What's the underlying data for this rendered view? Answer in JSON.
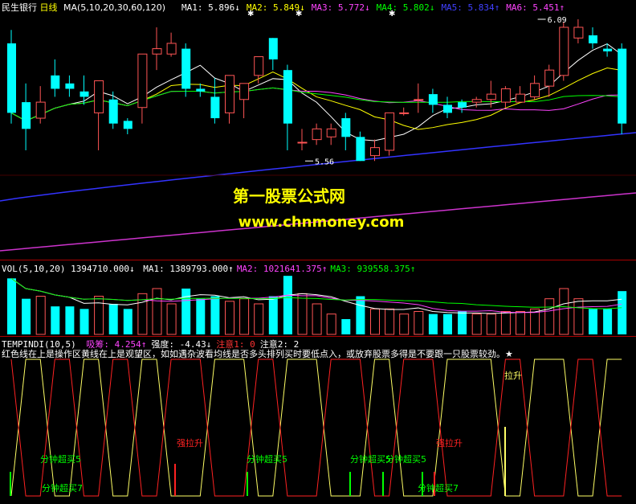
{
  "header": {
    "stock_name": "民生银行",
    "period": "日线",
    "ma_label": "MA(5,10,20,30,60,120)",
    "ma": [
      {
        "label": "MA1:",
        "value": "5.896",
        "arrow": "↓",
        "color": "#ffffff"
      },
      {
        "label": "MA2:",
        "value": "5.849",
        "arrow": "↓",
        "color": "#ffff00"
      },
      {
        "label": "MA3:",
        "value": "5.772",
        "arrow": "↓",
        "color": "#ff44ff"
      },
      {
        "label": "MA4:",
        "value": "5.802",
        "arrow": "↓",
        "color": "#00ff00"
      },
      {
        "label": "MA5:",
        "value": "5.834",
        "arrow": "↑",
        "color": "#4040ff"
      },
      {
        "label": "MA6:",
        "value": "5.451",
        "arrow": "↑",
        "color": "#ff44ff"
      }
    ]
  },
  "watermark": {
    "line1": "第一股票公式网",
    "line2": "www.chnmoney.com"
  },
  "vol_header": {
    "label": "VOL(5,10,20)",
    "value": "1394710.000",
    "arrow": "↓",
    "ma": [
      {
        "label": "MA1:",
        "value": "1389793.000",
        "arrow": "↑",
        "color": "#ffffff"
      },
      {
        "label": "MA2:",
        "value": "1021641.375",
        "arrow": "↑",
        "color": "#ff44ff"
      },
      {
        "label": "MA3:",
        "value": "939558.375",
        "arrow": "↑",
        "color": "#00ff00"
      }
    ]
  },
  "ind_header": {
    "label": "TEMPINDI(10,5)",
    "items": [
      {
        "text": "吸筹: 4.254↑",
        "color": "#ff44ff"
      },
      {
        "text": "强度: -4.43↓",
        "color": "#ffffff"
      },
      {
        "text": "注意1: 0",
        "color": "#ff3333"
      },
      {
        "text": "注意2: 2",
        "color": "#ffffff"
      }
    ],
    "note": "红色线在上是操作区黄线在上是观望区，如如遇杂波看均线是否多头排列买时要低点入，或放弃股票多得是不要跟一只股票较劲。★"
  },
  "chart_data": [
    {
      "type": "candlestick",
      "title": "民生银行 日线",
      "series_colors": {
        "up": "#ff5555",
        "down": "#00ffff"
      },
      "annotations": [
        {
          "text": "6.09",
          "x": 36
        },
        {
          "text": "5.56",
          "x": 20
        }
      ],
      "candles": [
        {
          "o": 6.0,
          "h": 6.05,
          "c": 5.74,
          "l": 5.7
        },
        {
          "o": 5.78,
          "h": 5.85,
          "c": 5.68,
          "l": 5.6
        },
        {
          "o": 5.72,
          "h": 5.84,
          "c": 5.78,
          "l": 5.7
        },
        {
          "o": 5.88,
          "h": 5.94,
          "c": 5.83,
          "l": 5.8
        },
        {
          "o": 5.85,
          "h": 5.88,
          "c": 5.83,
          "l": 5.8
        },
        {
          "o": 5.82,
          "h": 5.88,
          "c": 5.8,
          "l": 5.77
        },
        {
          "o": 5.74,
          "h": 5.86,
          "c": 5.86,
          "l": 5.6
        },
        {
          "o": 5.79,
          "h": 5.82,
          "c": 5.7,
          "l": 5.68
        },
        {
          "o": 5.71,
          "h": 5.72,
          "c": 5.68,
          "l": 5.66
        },
        {
          "o": 5.76,
          "h": 5.96,
          "c": 5.96,
          "l": 5.7
        },
        {
          "o": 5.96,
          "h": 6.06,
          "c": 5.98,
          "l": 5.9
        },
        {
          "o": 5.96,
          "h": 6.04,
          "c": 6.0,
          "l": 5.95
        },
        {
          "o": 5.98,
          "h": 6.0,
          "c": 5.83,
          "l": 5.8
        },
        {
          "o": 5.83,
          "h": 5.85,
          "c": 5.82,
          "l": 5.8
        },
        {
          "o": 5.8,
          "h": 5.87,
          "c": 5.72,
          "l": 5.7
        },
        {
          "o": 5.74,
          "h": 5.88,
          "c": 5.88,
          "l": 5.7
        },
        {
          "o": 5.79,
          "h": 5.85,
          "c": 5.85,
          "l": 5.72
        },
        {
          "o": 5.88,
          "h": 5.95,
          "c": 5.95,
          "l": 5.85
        },
        {
          "o": 6.02,
          "h": 6.02,
          "c": 5.94,
          "l": 5.9
        },
        {
          "o": 5.9,
          "h": 5.92,
          "c": 5.7,
          "l": 5.6
        },
        {
          "o": 5.63,
          "h": 5.68,
          "c": 5.63,
          "l": 5.6
        },
        {
          "o": 5.64,
          "h": 5.7,
          "c": 5.68,
          "l": 5.62
        },
        {
          "o": 5.65,
          "h": 5.7,
          "c": 5.68,
          "l": 5.62
        },
        {
          "o": 5.72,
          "h": 5.74,
          "c": 5.65,
          "l": 5.6
        },
        {
          "o": 5.65,
          "h": 5.67,
          "c": 5.56,
          "l": 5.56
        },
        {
          "o": 5.58,
          "h": 5.64,
          "c": 5.61,
          "l": 5.56
        },
        {
          "o": 5.6,
          "h": 5.74,
          "c": 5.74,
          "l": 5.58
        },
        {
          "o": 5.74,
          "h": 5.76,
          "c": 5.74,
          "l": 5.73
        },
        {
          "o": 5.79,
          "h": 5.85,
          "c": 5.79,
          "l": 5.74
        },
        {
          "o": 5.81,
          "h": 5.83,
          "c": 5.77,
          "l": 5.74
        },
        {
          "o": 5.77,
          "h": 5.8,
          "c": 5.74,
          "l": 5.72
        },
        {
          "o": 5.78,
          "h": 5.79,
          "c": 5.76,
          "l": 5.74
        },
        {
          "o": 5.78,
          "h": 5.8,
          "c": 5.79,
          "l": 5.76
        },
        {
          "o": 5.79,
          "h": 5.86,
          "c": 5.81,
          "l": 5.76
        },
        {
          "o": 5.78,
          "h": 5.84,
          "c": 5.83,
          "l": 5.76
        },
        {
          "o": 5.78,
          "h": 5.84,
          "c": 5.81,
          "l": 5.79
        },
        {
          "o": 5.8,
          "h": 5.88,
          "c": 5.85,
          "l": 5.79
        },
        {
          "o": 5.84,
          "h": 5.92,
          "c": 5.9,
          "l": 5.8
        },
        {
          "o": 5.88,
          "h": 6.08,
          "c": 6.06,
          "l": 5.86
        },
        {
          "o": 6.02,
          "h": 6.09,
          "c": 6.06,
          "l": 6.0
        },
        {
          "o": 6.03,
          "h": 6.06,
          "c": 6.0,
          "l": 5.98
        },
        {
          "o": 5.98,
          "h": 6.0,
          "c": 5.97,
          "l": 5.95
        },
        {
          "o": 5.98,
          "h": 6.0,
          "c": 5.7,
          "l": 5.66
        }
      ]
    },
    {
      "type": "bar",
      "title": "VOL(5,10,20)",
      "values": [
        2.2,
        1.4,
        1.5,
        1.1,
        1.1,
        1.0,
        1.5,
        1.2,
        1.0,
        1.6,
        1.8,
        1.2,
        1.8,
        1.4,
        1.5,
        1.3,
        1.4,
        1.2,
        1.5,
        2.3,
        1.6,
        1.2,
        0.8,
        0.6,
        1.5,
        1.0,
        1.0,
        0.8,
        0.9,
        0.8,
        0.8,
        0.9,
        0.8,
        0.8,
        0.9,
        0.9,
        1.0,
        1.4,
        1.8,
        1.4,
        1.0,
        1.0,
        1.7
      ]
    },
    {
      "type": "line",
      "title": "TEMPINDI(10,5)",
      "labels": [
        "拉升",
        "强拉升",
        "强拉升",
        "分钟超买5",
        "分钟超买5",
        "分钟超买5",
        "分钟超买5",
        "分钟超买7",
        "分钟超买7"
      ]
    }
  ]
}
